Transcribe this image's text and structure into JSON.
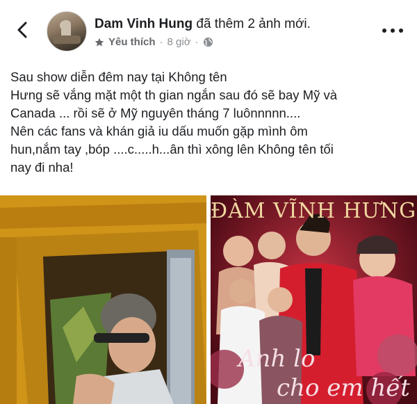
{
  "header": {
    "author": "Dam Vinh Hung",
    "action": " đã thêm 2 ảnh mới.",
    "follow_label": "Yêu thích",
    "separator": "·",
    "time": "8 giờ",
    "icons": [
      "back-arrow-icon",
      "star-icon",
      "globe-icon",
      "more-icon"
    ]
  },
  "post": {
    "lines": [
      "Sau show diễn đêm nay tại Không tên",
      "Hưng sẽ vắng mặt một th gian ngắn sau đó sẽ bay Mỹ và",
      "Canada ... rồi sẽ ở Mỹ nguyên tháng 7 luônnnnn....",
      "Nên các fans và khán giả iu dấu muốn gặp mình ôm",
      "hun,nắm tay  ,bóp ....c.....h...ân thì xông lên Không tên tối",
      "nay đi nha!"
    ]
  },
  "photos": {
    "poster_title": "ĐÀM VĨNH HƯNG",
    "poster_script": [
      "Anh lo",
      "cho em hết"
    ]
  },
  "colors": {
    "text": "#1c1e21",
    "meta": "#8a8d91",
    "poster_bg": "#7a1622"
  }
}
